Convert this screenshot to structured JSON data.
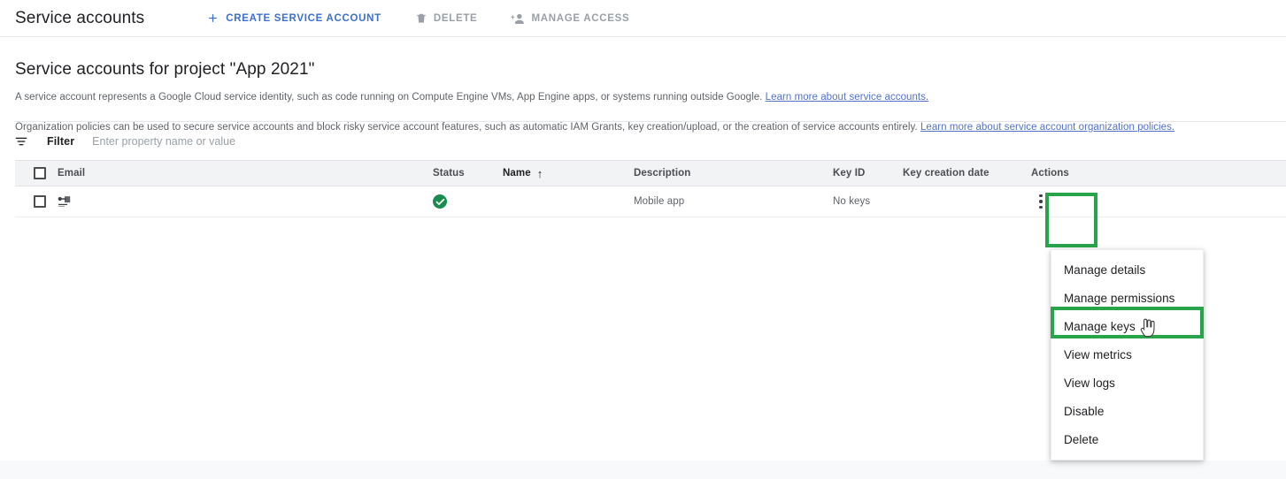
{
  "toolbar": {
    "title": "Service accounts",
    "buttons": [
      {
        "label": "CREATE SERVICE ACCOUNT",
        "icon": "plus-icon",
        "state": "enabled"
      },
      {
        "label": "DELETE",
        "icon": "trash-icon",
        "state": "disabled"
      },
      {
        "label": "MANAGE ACCESS",
        "icon": "person-add-icon",
        "state": "disabled"
      }
    ]
  },
  "page": {
    "heading": "Service accounts for project \"App 2021\"",
    "description_1_text": "A service account represents a Google Cloud service identity, such as code running on Compute Engine VMs, App Engine apps, or systems running outside Google.",
    "description_1_link": "Learn more about service accounts.",
    "description_2_text": "Organization policies can be used to secure service accounts and block risky service account features, such as automatic IAM Grants, key creation/upload, or the creation of service accounts entirely.",
    "description_2_link": "Learn more about service account organization policies."
  },
  "filter": {
    "label": "Filter",
    "placeholder": "Enter property name or value",
    "value": "",
    "icon": "filter-icon"
  },
  "table": {
    "columns": [
      {
        "key": "email",
        "label": "Email"
      },
      {
        "key": "status",
        "label": "Status"
      },
      {
        "key": "name",
        "label": "Name",
        "sorted": true,
        "sort_direction": "↑"
      },
      {
        "key": "description",
        "label": "Description"
      },
      {
        "key": "key_id",
        "label": "Key ID"
      },
      {
        "key": "key_creation_date",
        "label": "Key creation date"
      },
      {
        "key": "actions",
        "label": "Actions"
      }
    ],
    "rows": [
      {
        "email": "",
        "email_icon": "key-badge-icon",
        "status_icon": "check-circle-icon",
        "name": "",
        "description": "Mobile app",
        "key_id": "No keys",
        "key_creation_date": "",
        "actions_icon": "kebab-menu-icon"
      }
    ]
  },
  "menu": {
    "items": [
      {
        "label": "Manage details",
        "hovered": false
      },
      {
        "label": "Manage permissions",
        "hovered": false
      },
      {
        "label": "Manage keys",
        "hovered": true
      },
      {
        "label": "View metrics",
        "hovered": false
      },
      {
        "label": "View logs",
        "hovered": false
      },
      {
        "label": "Disable",
        "hovered": false
      },
      {
        "label": "Delete",
        "hovered": false
      }
    ]
  },
  "annotations": {
    "highlight_color": "#28a44a",
    "highlights": [
      {
        "name": "actions-column-highlight",
        "target": "Actions"
      },
      {
        "name": "manage-keys-highlight",
        "target": "Manage keys"
      }
    ]
  },
  "colors": {
    "link": "#5572c6",
    "primary_action": "#3c6fd0",
    "disabled_text": "#9aa0a6",
    "status_ok": "#198c4e",
    "header_bg": "#f1f3f4"
  },
  "cursor": {
    "type": "pointer-hand-cursor"
  }
}
